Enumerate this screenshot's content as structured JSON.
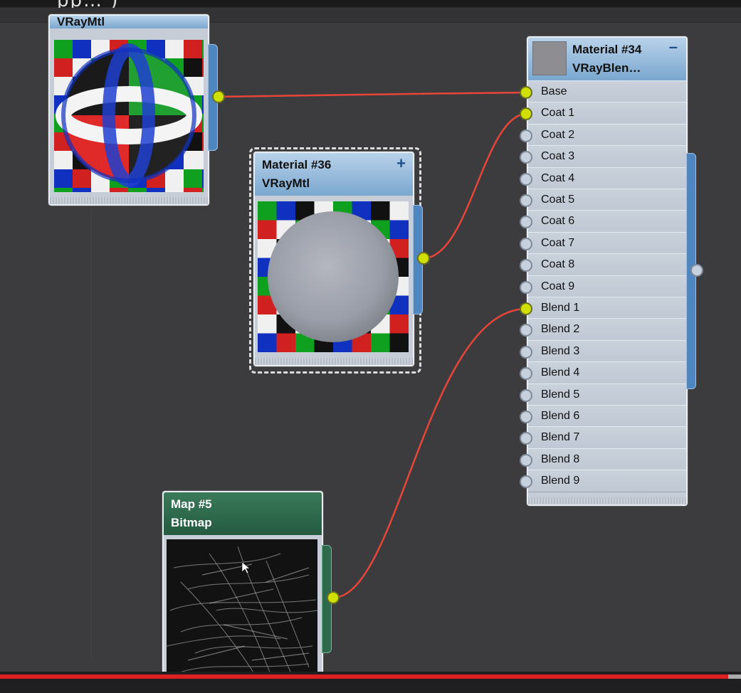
{
  "window": {
    "title_fragment": "pp…                          )"
  },
  "nodes": {
    "top_left": {
      "subtitle": "VRayMtl"
    },
    "material36": {
      "title": "Material #36",
      "subtitle": "VRayMtl",
      "expand_glyph": "+"
    },
    "material34": {
      "title": "Material #34",
      "subtitle": "VRayBlen…",
      "collapse_glyph": "–"
    },
    "map5": {
      "title": "Map #5",
      "subtitle": "Bitmap"
    }
  },
  "slots": [
    {
      "label": "Base",
      "connected": true
    },
    {
      "label": "Coat 1",
      "connected": true
    },
    {
      "label": "Coat 2",
      "connected": false
    },
    {
      "label": "Coat 3",
      "connected": false
    },
    {
      "label": "Coat 4",
      "connected": false
    },
    {
      "label": "Coat 5",
      "connected": false
    },
    {
      "label": "Coat 6",
      "connected": false
    },
    {
      "label": "Coat 7",
      "connected": false
    },
    {
      "label": "Coat 8",
      "connected": false
    },
    {
      "label": "Coat 9",
      "connected": false
    },
    {
      "label": "Blend 1",
      "connected": true
    },
    {
      "label": "Blend 2",
      "connected": false
    },
    {
      "label": "Blend 3",
      "connected": false
    },
    {
      "label": "Blend 4",
      "connected": false
    },
    {
      "label": "Blend 5",
      "connected": false
    },
    {
      "label": "Blend 6",
      "connected": false
    },
    {
      "label": "Blend 7",
      "connected": false
    },
    {
      "label": "Blend 8",
      "connected": false
    },
    {
      "label": "Blend 9",
      "connected": false
    }
  ],
  "colors": {
    "wire": "#e8453a",
    "port_connected": "#d0e000",
    "material_header": "#7aa7cf",
    "map_header": "#2d6a4d",
    "video_progress": "#e02020"
  },
  "video": {
    "progress": 0.983
  }
}
